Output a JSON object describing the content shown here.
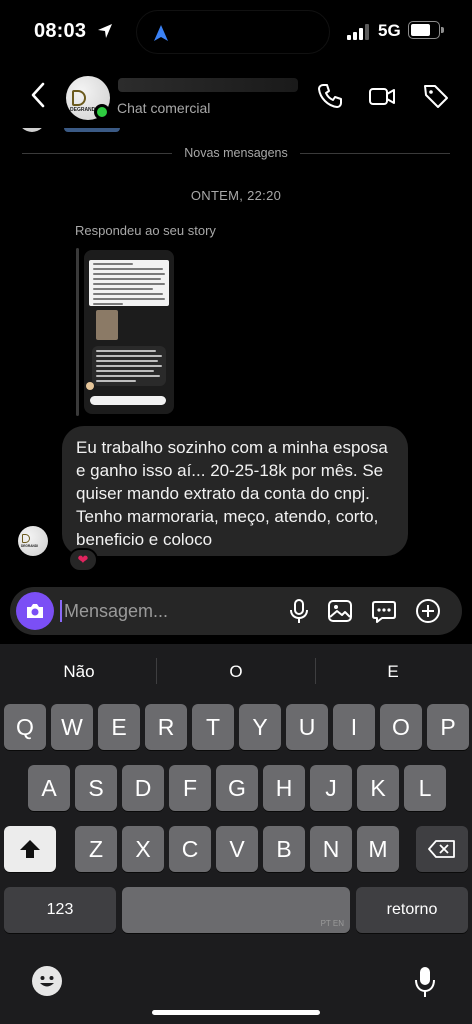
{
  "status_bar": {
    "time": "08:03",
    "network": "5G",
    "battery_level": 0.72
  },
  "header": {
    "subtitle": "Chat comercial",
    "avatar_logo_text": "DEGRANDI"
  },
  "chat": {
    "divider_label": "Novas mensagens",
    "timestamp": "ONTEM, 22:20",
    "story_reply_label": "Respondeu ao seu story",
    "message": "Eu trabalho sozinho com a minha esposa e ganho isso aí... 20-25-18k por mês. Se quiser mando extrato da conta do cnpj. Tenho marmoraria, meço, atendo, corto, beneficio e coloco",
    "reaction": "❤"
  },
  "composer": {
    "placeholder": "Mensagem..."
  },
  "keyboard": {
    "suggestions": [
      "Não",
      "O",
      "E"
    ],
    "row1": [
      "Q",
      "W",
      "E",
      "R",
      "T",
      "Y",
      "U",
      "I",
      "O",
      "P"
    ],
    "row2": [
      "A",
      "S",
      "D",
      "F",
      "G",
      "H",
      "J",
      "K",
      "L"
    ],
    "row3": [
      "Z",
      "X",
      "C",
      "V",
      "B",
      "N",
      "M"
    ],
    "numbers_label": "123",
    "space_language": "PT EN",
    "return_label": "retorno"
  }
}
